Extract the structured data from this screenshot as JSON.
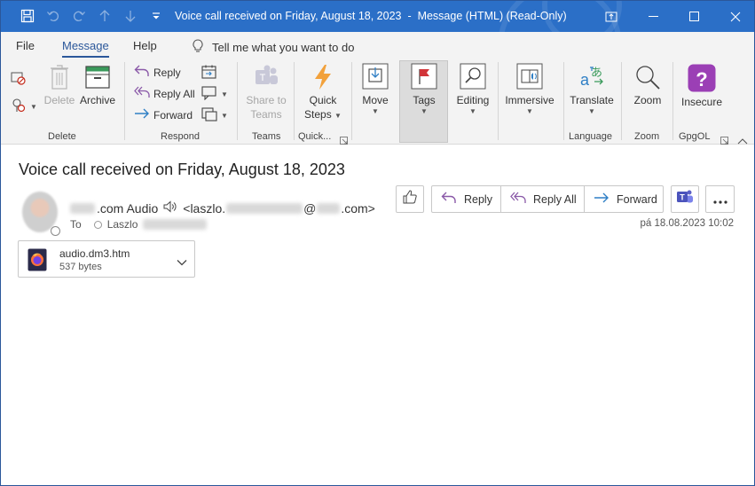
{
  "window": {
    "title": "Voice call received on Friday, August 18, 2023",
    "title_sep": "-",
    "title_suffix": "Message (HTML) (Read-Only)"
  },
  "menu": {
    "tabs": [
      "File",
      "Message",
      "Help"
    ],
    "active_tab": "Message",
    "tell_me": "Tell me what you want to do"
  },
  "ribbon": {
    "groups": {
      "delete": "Delete",
      "respond": "Respond",
      "teams": "Teams",
      "quick": "Quick...",
      "language": "Language",
      "zoom": "Zoom",
      "gpgol": "GpgOL"
    },
    "buttons": {
      "delete": "Delete",
      "archive": "Archive",
      "reply": "Reply",
      "reply_all": "Reply All",
      "forward": "Forward",
      "share_to_teams_1": "Share to",
      "share_to_teams_2": "Teams",
      "quick_steps_1": "Quick",
      "quick_steps_2": "Steps",
      "move": "Move",
      "tags": "Tags",
      "editing": "Editing",
      "immersive": "Immersive",
      "translate": "Translate",
      "zoom": "Zoom",
      "insecure": "Insecure"
    }
  },
  "message": {
    "subject": "Voice call received on Friday, August 18, 2023",
    "sender_domain_suffix": ".com Audio",
    "sender_email_prefix": "<laszlo.",
    "sender_email_at": "@",
    "sender_email_suffix": ".com>",
    "to_label": "To",
    "to_name": "Laszlo",
    "date": "pá 18.08.2023 10:02",
    "actions": {
      "reply": "Reply",
      "reply_all": "Reply All",
      "forward": "Forward"
    },
    "attachment": {
      "name": "audio.dm3.htm",
      "size": "537 bytes"
    }
  },
  "colors": {
    "titlebar": "#2b6fc7",
    "accent": "#2b579a",
    "reply_purple": "#8a59a8",
    "forward_blue": "#2f7fc5",
    "gpgol_purple": "#9b3fb5",
    "orange": "#f2a13b"
  }
}
